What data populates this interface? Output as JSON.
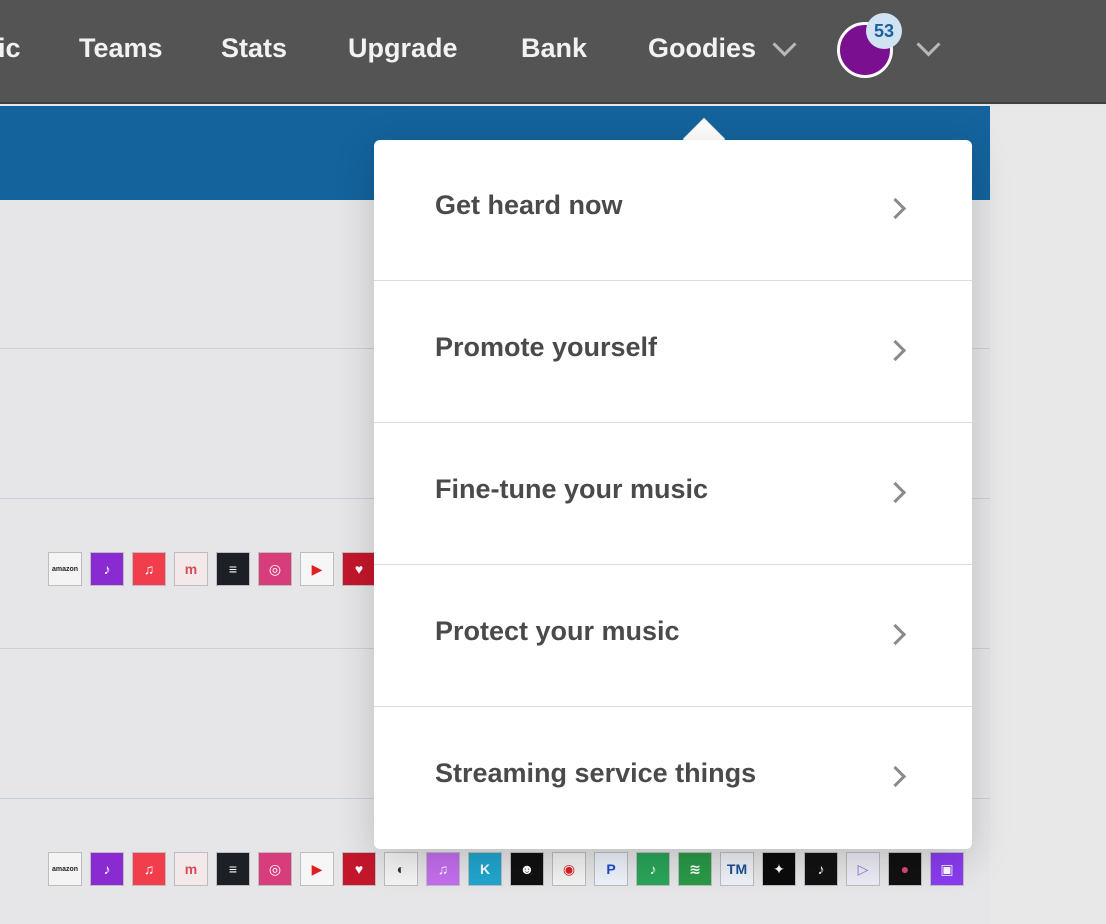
{
  "nav": {
    "items": [
      {
        "label": "ic"
      },
      {
        "label": "Teams"
      },
      {
        "label": "Stats"
      },
      {
        "label": "Upgrade"
      },
      {
        "label": "Bank"
      },
      {
        "label": "Goodies"
      }
    ],
    "notification_count": "53",
    "avatar_color": "#7a0f8f"
  },
  "dropdown": {
    "items": [
      {
        "label": "Get heard now"
      },
      {
        "label": "Promote yourself"
      },
      {
        "label": "Fine-tune your music"
      },
      {
        "label": "Protect your music"
      },
      {
        "label": "Streaming service things"
      }
    ]
  },
  "services": {
    "row1": [
      "amazon-music",
      "anghami",
      "apple-music",
      "mixcloud",
      "deezer",
      "instagram",
      "youtube-music",
      "iheartradio"
    ],
    "row1_amazon_text": "amazon",
    "row2": [
      "amazon-music",
      "anghami",
      "apple-music",
      "mixcloud",
      "deezer",
      "instagram",
      "youtube-music",
      "iheartradio",
      "kkbox-headphones",
      "itunes",
      "kkbox",
      "napster",
      "netease",
      "pandora",
      "jiosaavn",
      "spotify",
      "tencent",
      "tidal",
      "tiktok",
      "triller",
      "resso",
      "twitch"
    ],
    "row2_amazon_text": "amazon"
  },
  "colors": {
    "nav_bg": "#545454",
    "banner_blue": "#14639d",
    "page_bg": "#e6e6e8"
  }
}
